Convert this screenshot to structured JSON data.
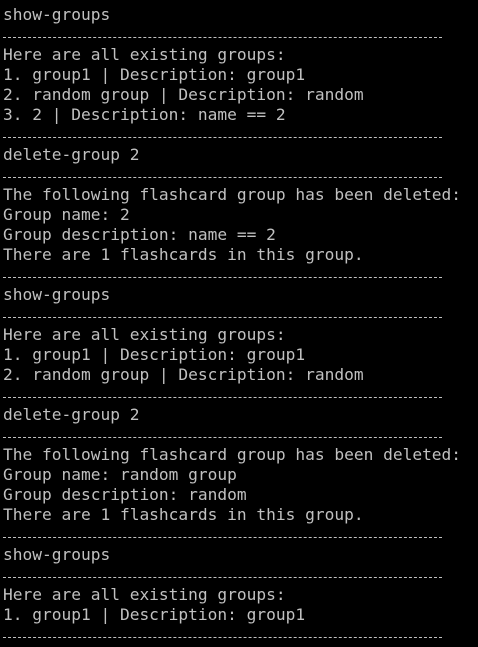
{
  "terminal": {
    "lines": [
      {
        "text": "show-groups",
        "kind": "command"
      },
      {
        "text": "",
        "kind": "separator"
      },
      {
        "text": "Here are all existing groups:",
        "kind": "output"
      },
      {
        "text": "1. group1 | Description: group1",
        "kind": "output"
      },
      {
        "text": "2. random group | Description: random",
        "kind": "output"
      },
      {
        "text": "3. 2 | Description: name == 2",
        "kind": "output"
      },
      {
        "text": "",
        "kind": "separator"
      },
      {
        "text": "delete-group 2",
        "kind": "command"
      },
      {
        "text": "",
        "kind": "separator"
      },
      {
        "text": "The following flashcard group has been deleted:",
        "kind": "output"
      },
      {
        "text": "Group name: 2",
        "kind": "output"
      },
      {
        "text": "Group description: name == 2",
        "kind": "output"
      },
      {
        "text": "There are 1 flashcards in this group.",
        "kind": "output"
      },
      {
        "text": "",
        "kind": "separator"
      },
      {
        "text": "show-groups",
        "kind": "command"
      },
      {
        "text": "",
        "kind": "separator"
      },
      {
        "text": "Here are all existing groups:",
        "kind": "output"
      },
      {
        "text": "1. group1 | Description: group1",
        "kind": "output"
      },
      {
        "text": "2. random group | Description: random",
        "kind": "output"
      },
      {
        "text": "",
        "kind": "separator"
      },
      {
        "text": "delete-group 2",
        "kind": "command"
      },
      {
        "text": "",
        "kind": "separator"
      },
      {
        "text": "The following flashcard group has been deleted:",
        "kind": "output"
      },
      {
        "text": "Group name: random group",
        "kind": "output"
      },
      {
        "text": "Group description: random",
        "kind": "output"
      },
      {
        "text": "There are 1 flashcards in this group.",
        "kind": "output"
      },
      {
        "text": "",
        "kind": "separator"
      },
      {
        "text": "show-groups",
        "kind": "command"
      },
      {
        "text": "",
        "kind": "separator"
      },
      {
        "text": "Here are all existing groups:",
        "kind": "output"
      },
      {
        "text": "1. group1 | Description: group1",
        "kind": "output"
      },
      {
        "text": "",
        "kind": "separator"
      }
    ],
    "colors": {
      "background": "#000000",
      "foreground": "#c0c0c0"
    }
  }
}
